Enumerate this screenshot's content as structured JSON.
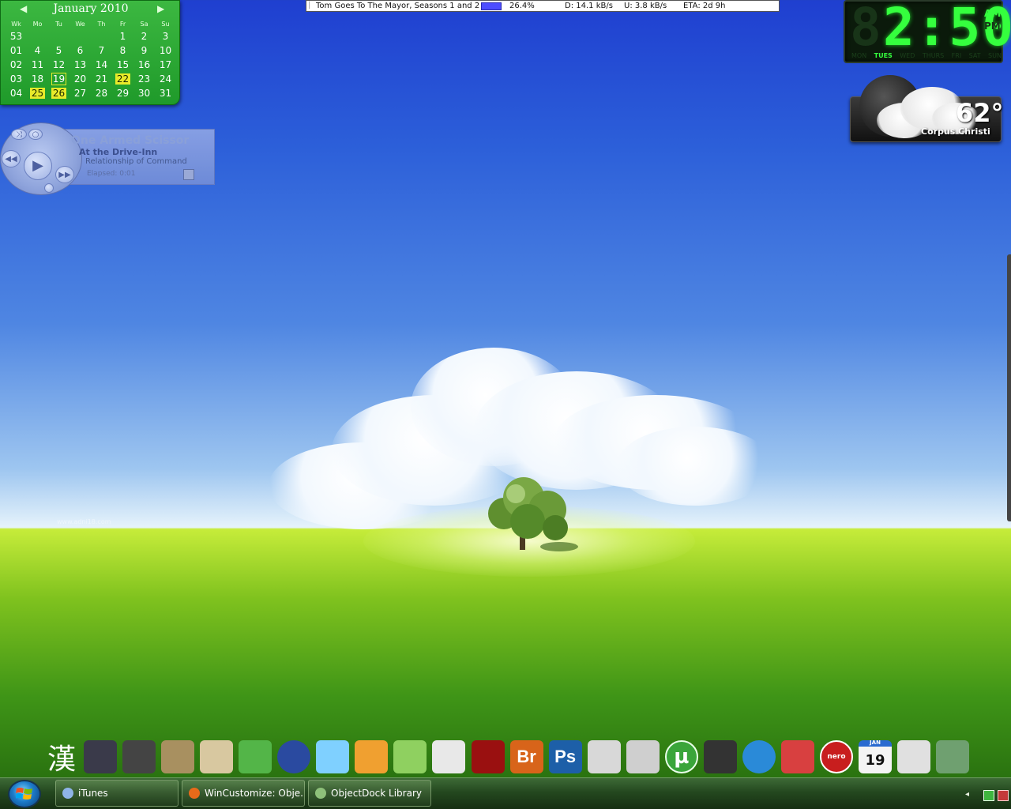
{
  "calendar": {
    "title": "January 2010",
    "prev_arrow": "◀",
    "next_arrow": "▶",
    "headers": [
      "Wk",
      "Mo",
      "Tu",
      "We",
      "Th",
      "Fr",
      "Sa",
      "Su"
    ],
    "rows": [
      [
        "53",
        "",
        "",
        "",
        "",
        "1",
        "2",
        "3"
      ],
      [
        "01",
        "4",
        "5",
        "6",
        "7",
        "8",
        "9",
        "10"
      ],
      [
        "02",
        "11",
        "12",
        "13",
        "14",
        "15",
        "16",
        "17"
      ],
      [
        "03",
        "18",
        "19",
        "20",
        "21",
        "22",
        "23",
        "24"
      ],
      [
        "04",
        "25",
        "26",
        "27",
        "28",
        "29",
        "30",
        "31"
      ]
    ]
  },
  "music": {
    "title": "One Armed Scissor",
    "album": "At the Drive-Inn",
    "track": "Relationship of Command",
    "elapsed": "Elapsed: 0:01",
    "icons": [
      "shuffle-icon",
      "repeat-icon",
      "previous-icon",
      "play-icon",
      "next-icon",
      "document-icon"
    ]
  },
  "torrent": {
    "name": "Tom Goes To The Mayor, Seasons 1 and 2",
    "progress": "26.4%",
    "progress_value": 0.264,
    "download": "D: 14.1 kB/s",
    "upload": "U: 3.8 kB/s",
    "eta": "ETA: 2d 9h",
    "bar_color": "#4d4dff"
  },
  "clock": {
    "time": "2:50",
    "am": "AM",
    "pm": "PM",
    "days": [
      "MON",
      "TUES",
      "WED",
      "THURS",
      "FRI",
      "SAT",
      "SUN"
    ],
    "active_day": "TUES",
    "color": "#35ff3e"
  },
  "weather": {
    "temperature": "62°",
    "city": "Corpus Christi"
  },
  "wallpaper": {
    "watermark": "www.adni18.com"
  },
  "dock": {
    "items": [
      {
        "name": "kanji-app-icon",
        "glyph": "漢"
      },
      {
        "name": "computer-tower-icon"
      },
      {
        "name": "camera-icon"
      },
      {
        "name": "scanner-icon"
      },
      {
        "name": "paint-tools-icon"
      },
      {
        "name": "yoshi-icon"
      },
      {
        "name": "neptune-planet-icon"
      },
      {
        "name": "winamp-icon"
      },
      {
        "name": "pidgin-icon"
      },
      {
        "name": "sonar-icon"
      },
      {
        "name": "windows-explorer-icon"
      },
      {
        "name": "gears-of-war-icon"
      },
      {
        "name": "adobe-bridge-icon",
        "label": "Br"
      },
      {
        "name": "adobe-photoshop-icon",
        "label": "Ps"
      },
      {
        "name": "apple-icon"
      },
      {
        "name": "nes-console-icon"
      },
      {
        "name": "utorrent-icon",
        "label": "µ"
      },
      {
        "name": "video-camera-icon"
      },
      {
        "name": "spinning-globe-icon"
      },
      {
        "name": "ccleaner-icon"
      },
      {
        "name": "nero-icon",
        "label": "nero"
      },
      {
        "name": "calendar-date-icon",
        "label": "JAN",
        "day": "19"
      },
      {
        "name": "calculator-icon"
      },
      {
        "name": "aquarium-icon"
      }
    ]
  },
  "taskbar": {
    "tasks": [
      {
        "label": "iTunes",
        "icon": "itunes-icon",
        "color": "#8fb4e8"
      },
      {
        "label": "WinCustomize: Obje...",
        "icon": "firefox-icon",
        "color": "#e86a1a"
      },
      {
        "label": "ObjectDock Library",
        "icon": "objectdock-icon",
        "color": "#8ec07a"
      }
    ],
    "tray_arrow": "◂"
  }
}
